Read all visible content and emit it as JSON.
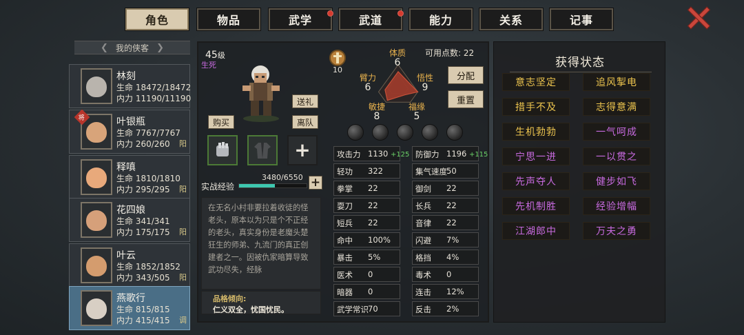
{
  "tabs": [
    {
      "label": "角色",
      "active": true,
      "dot": false
    },
    {
      "label": "物品",
      "active": false,
      "dot": false
    },
    {
      "label": "武学",
      "active": false,
      "dot": true
    },
    {
      "label": "武道",
      "active": false,
      "dot": true
    },
    {
      "label": "能力",
      "active": false,
      "dot": false
    },
    {
      "label": "关系",
      "active": false,
      "dot": false
    },
    {
      "label": "记事",
      "active": false,
      "dot": false
    }
  ],
  "sidebar": {
    "header": "我的侠客",
    "characters": [
      {
        "name": "林刻",
        "hp": "生命 18472/18472",
        "mp": "内力 11190/11190",
        "tag": "",
        "badge": "",
        "selected": false,
        "color": "#b9b4ad"
      },
      {
        "name": "叶银瓶",
        "hp": "生命 7767/7767",
        "mp": "内力 260/260",
        "tag": "阳",
        "badge": "将",
        "selected": false,
        "color": "#d8a47a"
      },
      {
        "name": "释嗔",
        "hp": "生命 1810/1810",
        "mp": "内力 295/295",
        "tag": "阳",
        "badge": "",
        "selected": false,
        "color": "#e8a97b"
      },
      {
        "name": "花四娘",
        "hp": "生命 341/341",
        "mp": "内力 175/175",
        "tag": "阳",
        "badge": "",
        "selected": false,
        "color": "#d6a07a"
      },
      {
        "name": "叶云",
        "hp": "生命 1852/1852",
        "mp": "内力 343/505",
        "tag": "阳",
        "badge": "",
        "selected": false,
        "color": "#d49c6e"
      },
      {
        "name": "燕歌行",
        "hp": "生命 815/815",
        "mp": "内力 415/415",
        "tag": "调",
        "badge": "",
        "selected": true,
        "color": "#d8cfc4"
      }
    ]
  },
  "profile": {
    "level": "45",
    "level_unit": "级",
    "realm": "生死",
    "buttons": {
      "gift": "送礼",
      "buy": "购买",
      "leave": "离队"
    },
    "exp_label": "实战经验",
    "exp_text": "3480/6550",
    "exp_fraction": 0.53,
    "bio": "在无名小村非要拉着收徒的怪老头，原本以为只是个不正经的老头，真实身份是老魔头楚狂生的师弟、九流门的真正创建者之一。因被仇家暗算导致武功尽失，经脉",
    "pref_title": "品格倾向:",
    "pref_value": "仁义双全，忧国忧民。"
  },
  "attributes": {
    "medal_value": "10",
    "points_label": "可用点数:",
    "points": "22",
    "distribute": "分配",
    "reset": "重置",
    "items": [
      {
        "label": "体质",
        "value": "6"
      },
      {
        "label": "臂力",
        "value": "6"
      },
      {
        "label": "悟性",
        "value": "9"
      },
      {
        "label": "敏捷",
        "value": "8"
      },
      {
        "label": "福缘",
        "value": "5"
      }
    ],
    "radar_levels": [
      0.67,
      0.67,
      1.0,
      0.89,
      0.56
    ]
  },
  "stats_left": [
    {
      "k": "攻击力",
      "v": "1130",
      "bonus": "+125"
    },
    {
      "k": "轻功",
      "v": "322",
      "bonus": ""
    },
    {
      "k": "拳掌",
      "v": "22",
      "bonus": ""
    },
    {
      "k": "耍刀",
      "v": "22",
      "bonus": ""
    },
    {
      "k": "短兵",
      "v": "22",
      "bonus": ""
    },
    {
      "k": "命中",
      "v": "100%",
      "bonus": ""
    },
    {
      "k": "暴击",
      "v": "5%",
      "bonus": ""
    },
    {
      "k": "医术",
      "v": "0",
      "bonus": ""
    },
    {
      "k": "暗器",
      "v": "0",
      "bonus": ""
    },
    {
      "k": "武学常识",
      "v": "70",
      "bonus": ""
    }
  ],
  "stats_right": [
    {
      "k": "防御力",
      "v": "1196",
      "bonus": "+115"
    },
    {
      "k": "集气速度",
      "v": "50",
      "bonus": ""
    },
    {
      "k": "御剑",
      "v": "22",
      "bonus": ""
    },
    {
      "k": "长兵",
      "v": "22",
      "bonus": ""
    },
    {
      "k": "音律",
      "v": "22",
      "bonus": ""
    },
    {
      "k": "闪避",
      "v": "7%",
      "bonus": ""
    },
    {
      "k": "格挡",
      "v": "4%",
      "bonus": ""
    },
    {
      "k": "毒术",
      "v": "0",
      "bonus": ""
    },
    {
      "k": "连击",
      "v": "12%",
      "bonus": ""
    },
    {
      "k": "反击",
      "v": "2%",
      "bonus": ""
    }
  ],
  "status": {
    "title": "获得状态",
    "items": [
      {
        "label": "意志坚定",
        "color": "y"
      },
      {
        "label": "追风掣电",
        "color": "y"
      },
      {
        "label": "措手不及",
        "color": "y"
      },
      {
        "label": "志得意满",
        "color": "y"
      },
      {
        "label": "生机勃勃",
        "color": "y"
      },
      {
        "label": "一气呵成",
        "color": "p"
      },
      {
        "label": "宁思一进",
        "color": "p"
      },
      {
        "label": "一以贯之",
        "color": "p"
      },
      {
        "label": "先声夺人",
        "color": "p"
      },
      {
        "label": "健步如飞",
        "color": "p"
      },
      {
        "label": "先机制胜",
        "color": "p"
      },
      {
        "label": "经验增幅",
        "color": "p"
      },
      {
        "label": "江湖郎中",
        "color": "p"
      },
      {
        "label": "万夫之勇",
        "color": "p"
      }
    ]
  }
}
